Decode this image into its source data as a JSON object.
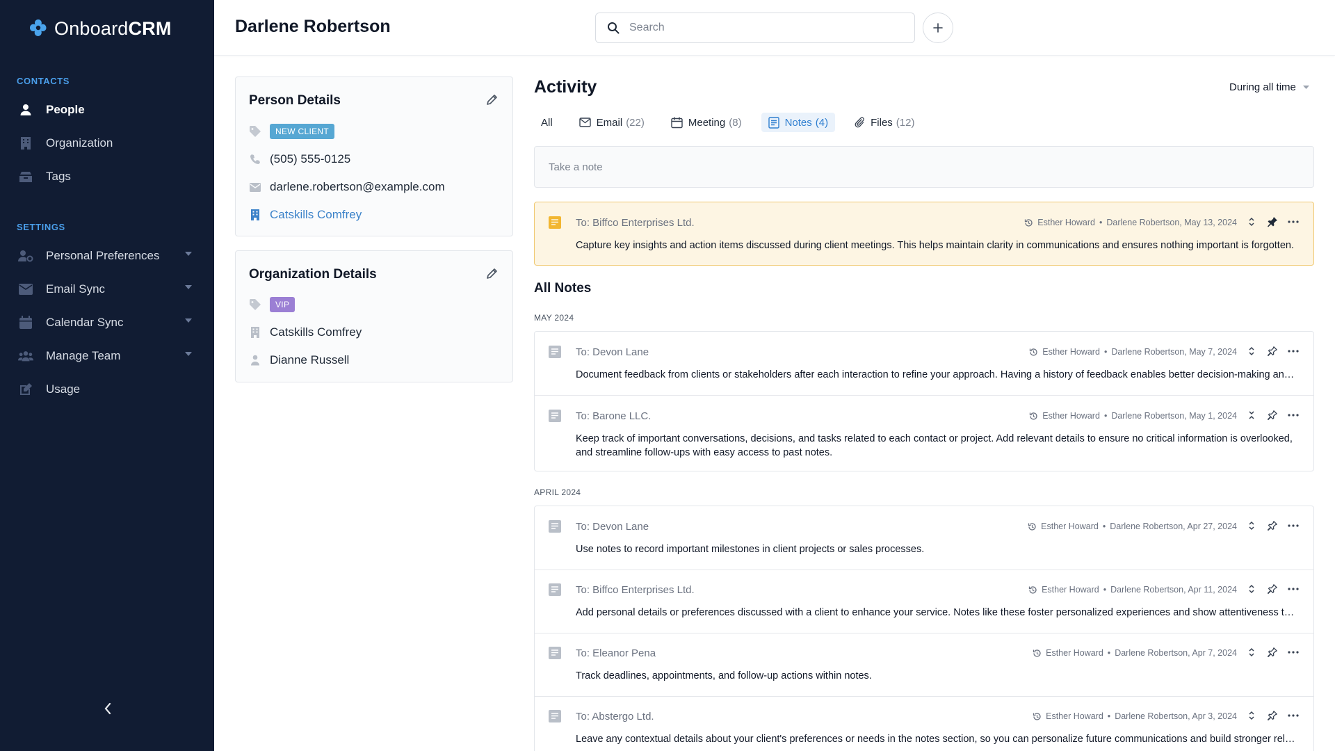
{
  "sidebar": {
    "logo_text_a": "Onboard",
    "logo_text_b": "CRM",
    "contacts_label": "CONTACTS",
    "settings_label": "SETTINGS",
    "contacts": [
      {
        "label": "People",
        "icon": "person-icon"
      },
      {
        "label": "Organization",
        "icon": "building-icon"
      },
      {
        "label": "Tags",
        "icon": "tags-icon"
      }
    ],
    "settings": [
      {
        "label": "Personal Preferences",
        "icon": "user-settings-icon"
      },
      {
        "label": "Email Sync",
        "icon": "mail-icon"
      },
      {
        "label": "Calendar Sync",
        "icon": "calendar-icon"
      },
      {
        "label": "Manage Team",
        "icon": "team-icon"
      },
      {
        "label": "Usage",
        "icon": "edit-icon"
      }
    ]
  },
  "header": {
    "title": "Darlene Robertson",
    "search_placeholder": "Search"
  },
  "person": {
    "title": "Person Details",
    "tag": "NEW CLIENT",
    "phone": "(505) 555-0125",
    "email": "darlene.robertson@example.com",
    "company": "Catskills Comfrey"
  },
  "org": {
    "title": "Organization Details",
    "tag": "VIP",
    "name": "Catskills Comfrey",
    "owner": "Dianne Russell"
  },
  "activity": {
    "title": "Activity",
    "period": "During all time",
    "tabs": [
      {
        "label": "All",
        "count": ""
      },
      {
        "label": "Email",
        "count": "(22)"
      },
      {
        "label": "Meeting",
        "count": "(8)"
      },
      {
        "label": "Notes",
        "count": "(4)"
      },
      {
        "label": "Files",
        "count": "(12)"
      }
    ],
    "note_placeholder": "Take a note",
    "all_notes_title": "All Notes"
  },
  "pinned": {
    "to": "To: Biffco Enterprises Ltd.",
    "author": "Esther Howard",
    "meta": "Darlene Robertson, May 13, 2024",
    "body": "Capture key insights and action items discussed during client meetings. This helps maintain clarity in communications and ensures nothing important is forgotten."
  },
  "groups": [
    {
      "label": "MAY 2024",
      "notes": [
        {
          "to": "To: Devon Lane",
          "author": "Esther Howard",
          "meta": "Darlene Robertson, May 7, 2024",
          "body": "Document feedback from clients or stakeholders after each interaction to refine your approach. Having a history of feedback enables better decision-making and growth."
        },
        {
          "to": "To: Barone LLC.",
          "author": "Esther Howard",
          "meta": "Darlene Robertson, May 1, 2024",
          "body": "Keep track of important conversations, decisions, and tasks related to each contact or project. Add relevant details to ensure no critical information is overlooked, and streamline follow-ups with easy access to past notes."
        }
      ]
    },
    {
      "label": "APRIL 2024",
      "notes": [
        {
          "to": "To: Devon Lane",
          "author": "Esther Howard",
          "meta": "Darlene Robertson, Apr 27, 2024",
          "body": "Use notes to record important milestones in client projects or sales processes."
        },
        {
          "to": "To: Biffco Enterprises Ltd.",
          "author": "Esther Howard",
          "meta": "Darlene Robertson, Apr 11, 2024",
          "body": "Add personal details or preferences discussed with a client to enhance your service. Notes like these foster personalized experiences and show attentiveness to their needs."
        },
        {
          "to": "To: Eleanor Pena",
          "author": "Esther Howard",
          "meta": "Darlene Robertson, Apr 7, 2024",
          "body": "Track deadlines, appointments, and follow-up actions within notes."
        },
        {
          "to": "To: Abstergo Ltd.",
          "author": "Esther Howard",
          "meta": "Darlene Robertson, Apr 3, 2024",
          "body": "Leave any contextual details about your client's preferences or needs in the notes section, so you can personalize future communications and build stronger relationships."
        }
      ]
    }
  ],
  "colors": {
    "sidebar_bg": "#111c33",
    "accent": "#2f7fd0",
    "new_client_badge": "#56a7d3",
    "vip_badge": "#9b7fd4",
    "pinned_bg": "#fdf5e3",
    "pinned_border": "#f0c870"
  }
}
